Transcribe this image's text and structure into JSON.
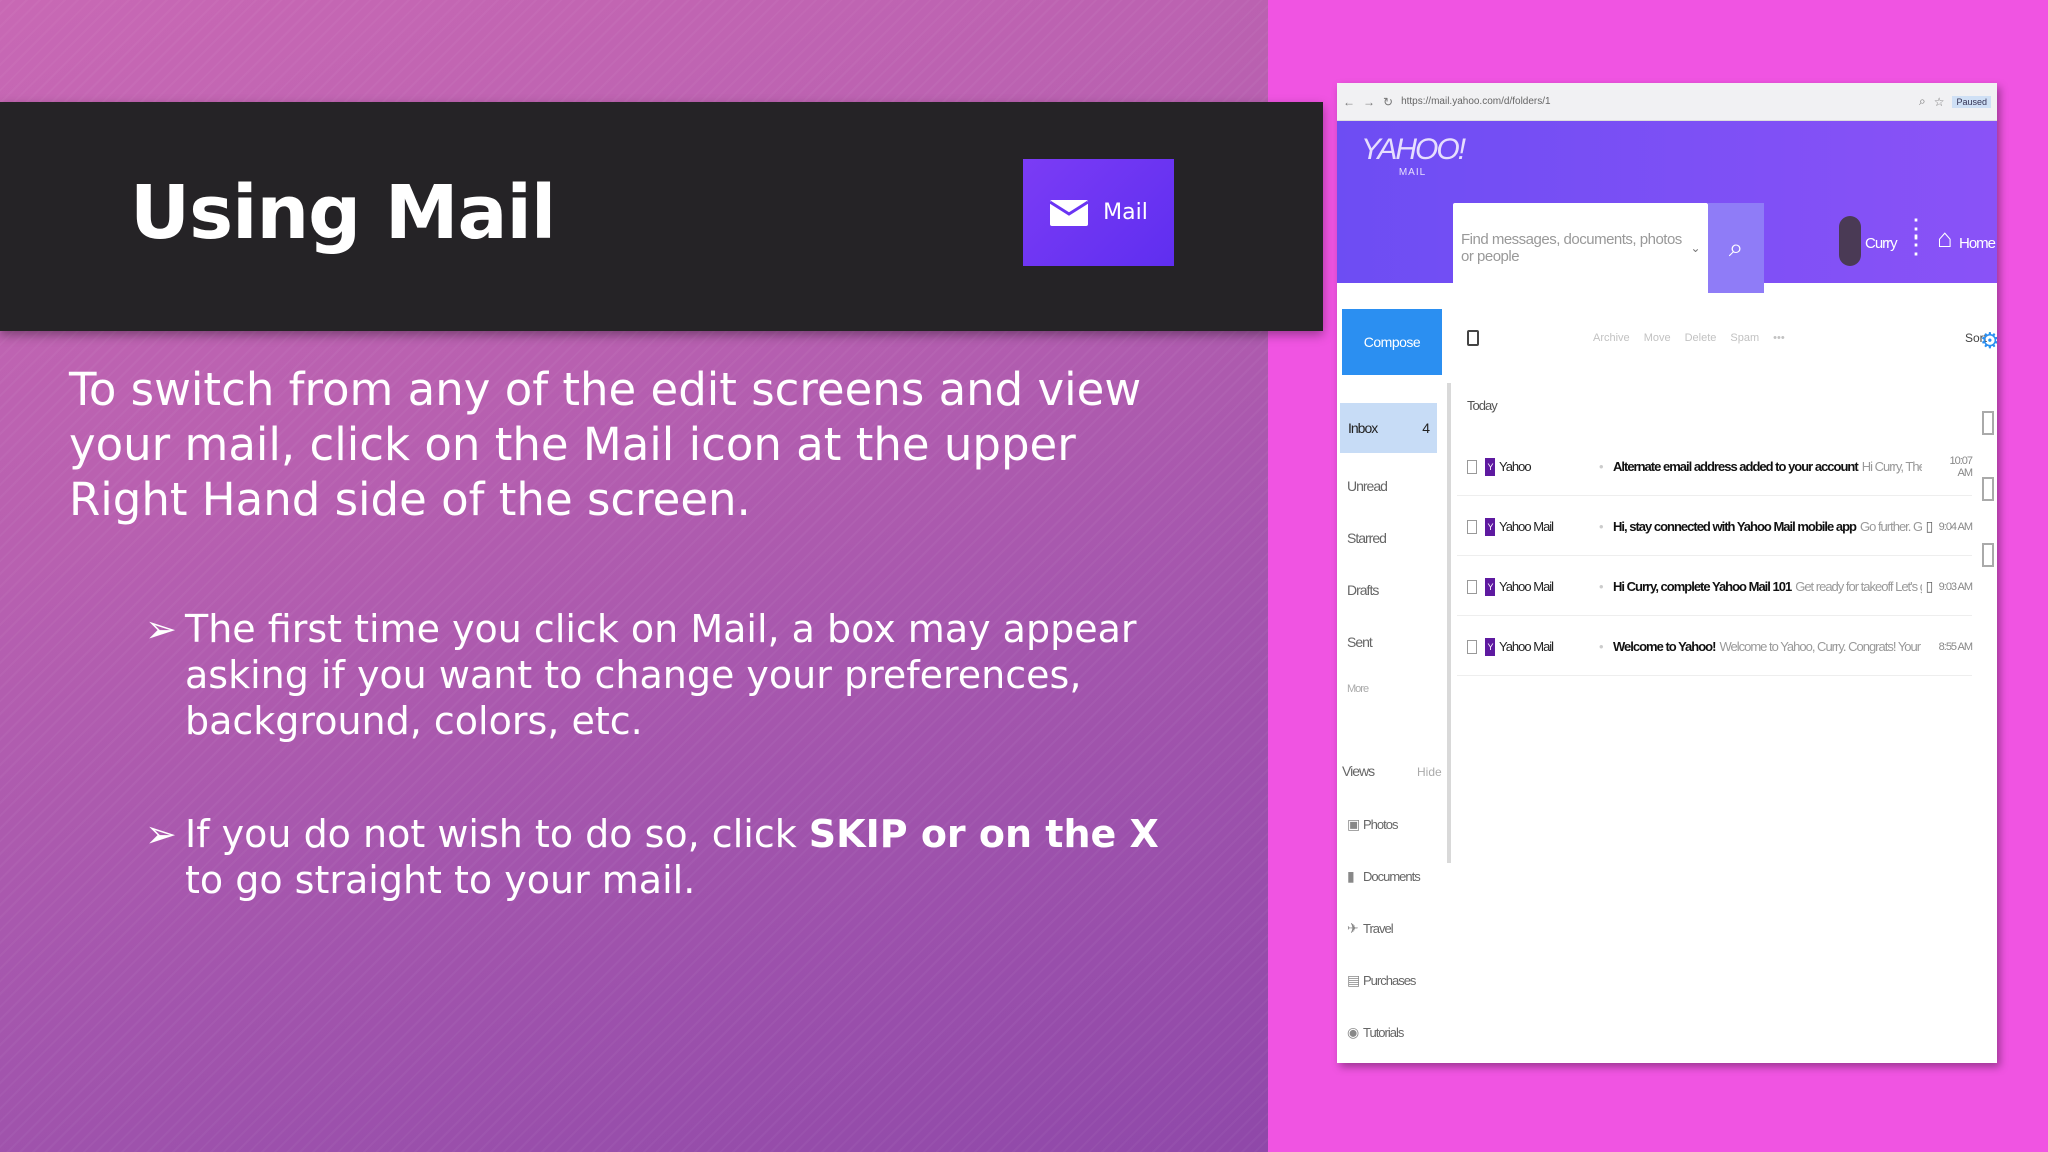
{
  "slide": {
    "title": "Using Mail",
    "mail_button_label": "Mail",
    "intro": "To switch from any of the edit screens and view your mail, click on the Mail icon at the upper Right Hand side of the screen.",
    "bullet_mark": "➢",
    "bullets": [
      {
        "text": "The first time you click on Mail, a box may appear asking if you want to change your preferences, background, colors, etc."
      },
      {
        "text_before": "If you do not wish to do so, click ",
        "text_bold": "SKIP or on the X",
        "text_after": " to go straight to your mail."
      }
    ],
    "colors": {
      "title_bar": "#252326",
      "accent_purple": "#6a34f3",
      "right_bg": "#f054e2"
    }
  },
  "screenshot": {
    "browser": {
      "url": "https://mail.yahoo.com/d/folders/1",
      "badge": "Paused"
    },
    "header": {
      "logo": "YAHOO!",
      "logo_sub": "MAIL",
      "search_placeholder": "Find messages, documents, photos or people",
      "user_name": "Curry",
      "home_label": "Home"
    },
    "sidebar": {
      "compose_label": "Compose",
      "inbox_label": "Inbox",
      "inbox_count": "4",
      "items": [
        "Unread",
        "Starred",
        "Drafts",
        "Sent",
        "More"
      ],
      "views_label": "Views",
      "hide_label": "Hide",
      "folders": [
        {
          "label": "Photos",
          "icon": "photo-icon"
        },
        {
          "label": "Documents",
          "icon": "document-icon"
        },
        {
          "label": "Travel",
          "icon": "plane-icon"
        },
        {
          "label": "Purchases",
          "icon": "receipt-icon"
        },
        {
          "label": "Tutorials",
          "icon": "tutorial-icon"
        }
      ]
    },
    "toolbar": {
      "archive": "Archive",
      "move": "Move",
      "delete": "Delete",
      "spam": "Spam",
      "more": "•••",
      "sort": "Sort"
    },
    "list": {
      "group_label": "Today",
      "messages": [
        {
          "sender": "Yahoo",
          "subject": "Alternate email address added to your account",
          "preview": "Hi Curry, The followi...",
          "time": "10:07 AM",
          "attachment": false
        },
        {
          "sender": "Yahoo Mail",
          "subject": "Hi, stay connected with Yahoo Mail mobile app",
          "preview": "Go further. Go faster...",
          "time": "9:04 AM",
          "attachment": true
        },
        {
          "sender": "Yahoo Mail",
          "subject": "Hi Curry, complete Yahoo Mail 101",
          "preview": "Get ready for takeoff Let's get g...",
          "time": "9:03 AM",
          "attachment": true
        },
        {
          "sender": "Yahoo Mail",
          "subject": "Welcome to Yahoo!",
          "preview": "Welcome to Yahoo, Curry. Congrats! Your userna...",
          "time": "8:55 AM",
          "attachment": false
        }
      ]
    }
  }
}
